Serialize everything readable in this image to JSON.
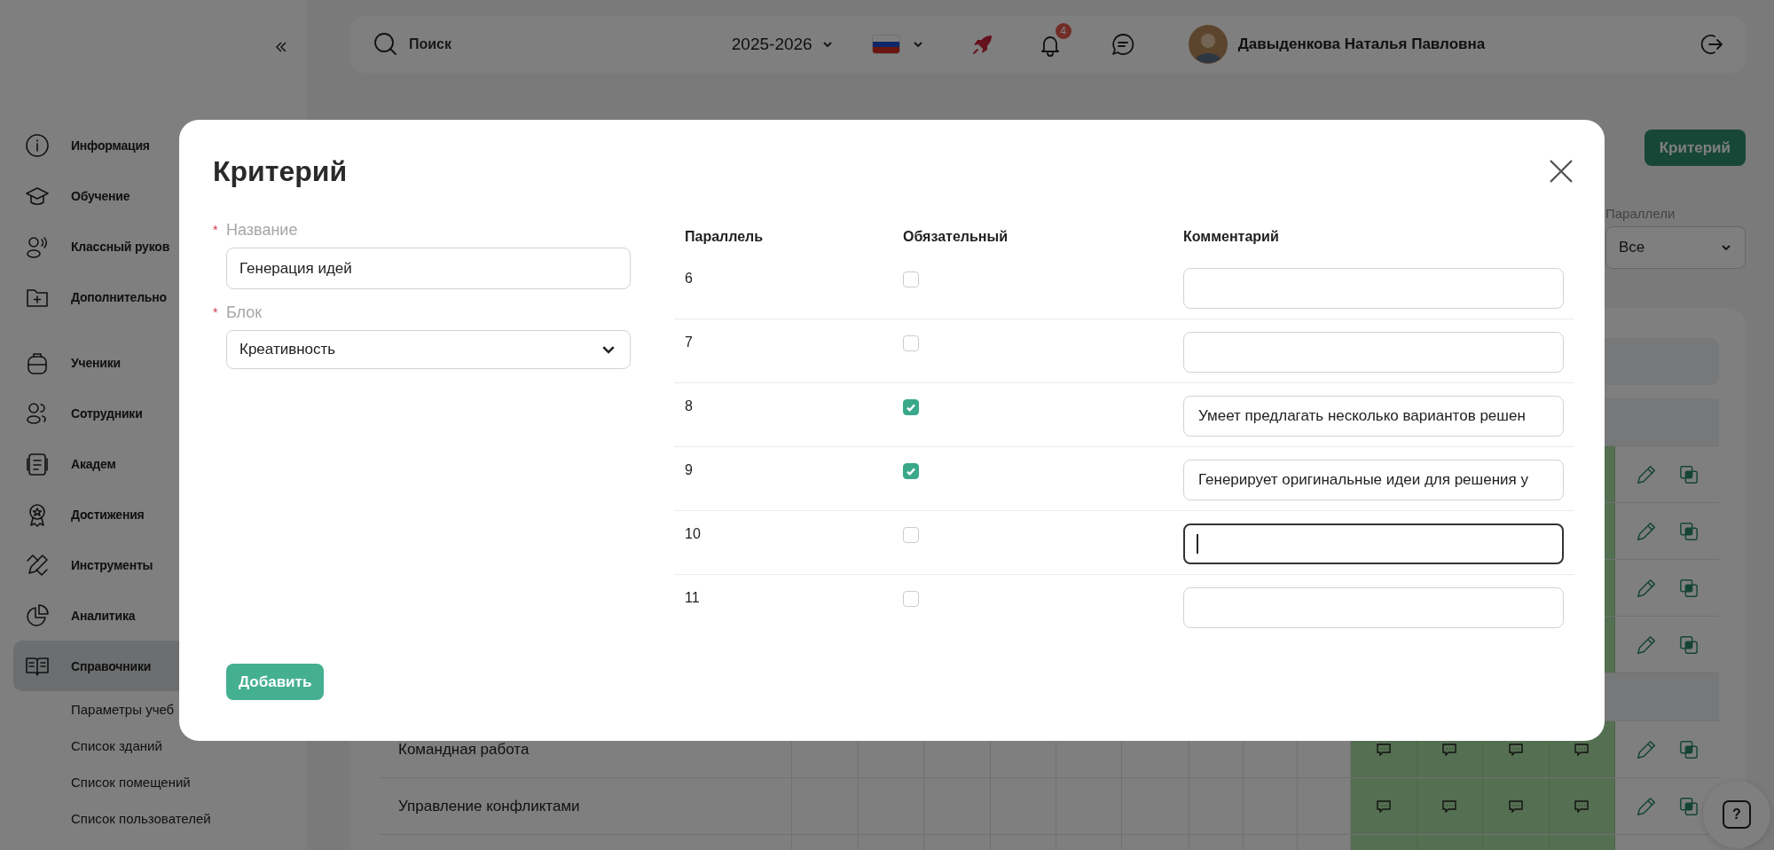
{
  "sidebar": {
    "sections": [
      {
        "items": [
          {
            "label": "Информация",
            "selected": false
          },
          {
            "label": "Обучение",
            "selected": false
          },
          {
            "label": "Классный руков",
            "selected": false
          },
          {
            "label": "Дополнительно",
            "selected": false
          }
        ]
      },
      {
        "items": [
          {
            "label": "Ученики",
            "selected": false
          },
          {
            "label": "Сотрудники",
            "selected": false
          },
          {
            "label": "Академ",
            "selected": false
          },
          {
            "label": "Достижения",
            "selected": false
          },
          {
            "label": "Инструменты",
            "selected": false
          },
          {
            "label": "Аналитика",
            "selected": false
          },
          {
            "label": "Справочники",
            "selected": true,
            "children": [
              {
                "label": "Параметры учеб"
              },
              {
                "label": "Список зданий"
              },
              {
                "label": "Список помещений"
              },
              {
                "label": "Список пользователей"
              }
            ]
          }
        ]
      }
    ]
  },
  "header": {
    "search": {
      "placeholder": "Поиск"
    },
    "year": "2025-2026",
    "notifications": "4",
    "user": "Давыденкова Наталья Павловна"
  },
  "toolbar": {
    "button": "Критерий"
  },
  "filter": {
    "label": "Параллели",
    "value": "Все"
  },
  "table": {
    "rows": [
      {
        "kind": "header"
      },
      {
        "kind": "group"
      },
      {
        "kind": "item"
      },
      {
        "kind": "item"
      },
      {
        "kind": "item"
      },
      {
        "kind": "item"
      },
      {
        "kind": "group"
      },
      {
        "kind": "item",
        "title": "Командная работа"
      },
      {
        "kind": "item",
        "title": "Управление конфликтами"
      },
      {
        "kind": "item"
      }
    ]
  },
  "modal": {
    "title": "Критерий",
    "fields": [
      {
        "kind": "text",
        "label": "Название",
        "required_mark": "*",
        "value": "Генерация идей"
      },
      {
        "kind": "select",
        "label": "Блок",
        "required_mark": "*",
        "value": "Креативность"
      }
    ],
    "table": {
      "columns": [
        "Параллель",
        "Обязательный",
        "Комментарий"
      ],
      "rows": [
        {
          "parallel": "6",
          "checked": false,
          "focused": false
        },
        {
          "parallel": "7",
          "checked": false,
          "focused": false
        },
        {
          "parallel": "8",
          "checked": true,
          "focused": false,
          "comment": "Умеет предлагать несколько вариантов решен"
        },
        {
          "parallel": "9",
          "checked": true,
          "focused": false,
          "comment": "Генерирует оригинальные идеи для решения у"
        },
        {
          "parallel": "10",
          "checked": false,
          "focused": true
        },
        {
          "parallel": "11",
          "checked": false,
          "focused": false
        }
      ]
    },
    "submit": "Добавить"
  },
  "help": "?"
}
